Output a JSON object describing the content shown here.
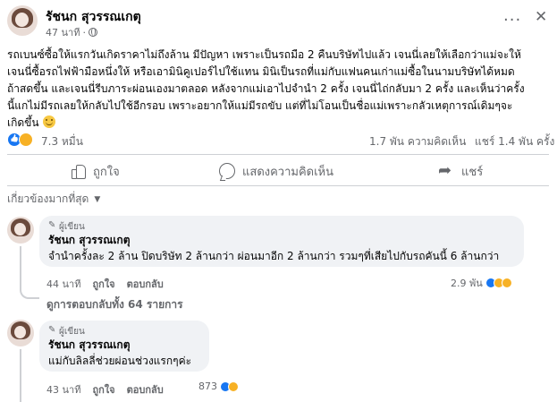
{
  "post": {
    "author": "รัชนก สุวรรณเกตุ",
    "time": "47 นาที",
    "body_lines": [
      "รถเบนซ์ซื้อให้แรกวันเกิดราคาไม่ถึงล้าน มีปัญหา เพราะเป็นรถมือ 2 คืนบริษัทไปแล้ว เจนนี่เลยให้เลือกว่าแม่จะให้",
      "เจนนี่ซื้อรถไฟฟ้ามือหนึ่งให้ หรือเอามินิคูเปอร์ไปใช้แทน มินิเป็นรถที่แม่กับแฟนคนเก่าแม่ซื้อในนามบริษัทได้หมด",
      "ถ้าสดขึ้น และเจนนี่รีบภาระผ่อนเองมาตลอด  หลังจากแม่เอาไปจำนำ 2 ครั้ง เจนนี่ไถ่กลับมา 2 ครั้ง และเห็นว่าครั้ง",
      "นี้แกไม่มีรถเลยให้กลับไปใช้อีกรอบ เพราะอยากให้แม่มีรถขับ แต่ที่ไม่โอนเป็นชื่อแม่เพราะกลัวเหตุการณ์เดิมๆจะ",
      "เกิดขึ้น"
    ]
  },
  "reactions": {
    "total": "7.3 หมื่น",
    "comments": "1.7 พัน ความคิดเห็น",
    "shares": "แชร์ 1.4 พัน ครั้ง",
    "colors": {
      "like": "#1877f2",
      "care": "#f7b125"
    }
  },
  "actions": {
    "like": "ถูกใจ",
    "comment": "แสดงความคิดเห็น",
    "share": "แชร์"
  },
  "filter": {
    "label": "เกี่ยวข้องมากที่สุด"
  },
  "comments": [
    {
      "badge": "ผู้เขียน",
      "author": "รัชนก สุวรรณเกตุ",
      "text": "จำนำครั้งละ 2 ล้าน ปิดบริษัท 2 ล้านกว่า ผ่อนมาอีก 2 ล้านกว่า รวมๆที่เสียไปกับรถคันนี้ 6 ล้านกว่า",
      "time": "44 นาที",
      "like": "ถูกใจ",
      "reply": "ตอบกลับ",
      "reaction_count": "2.9 พัน"
    },
    {
      "badge": "ผู้เขียน",
      "author": "รัชนก สุวรรณเกตุ",
      "text": "แม่กับลิลลี่ช่วยผ่อนช่วงแรกๆค่ะ",
      "time": "43 นาที",
      "like": "ถูกใจ",
      "reply": "ตอบกลับ",
      "reaction_count": "873"
    }
  ],
  "replies_link": "ดูการตอบกลับทั้ง 64 รายการ"
}
